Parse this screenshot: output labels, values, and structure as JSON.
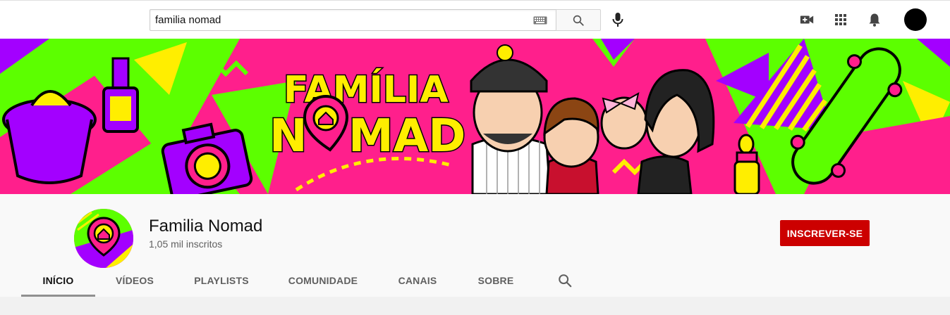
{
  "masthead": {
    "search_value": "familia nomad",
    "icons": [
      "keyboard-icon",
      "search-icon",
      "mic-icon",
      "create-video-icon",
      "apps-grid-icon",
      "bell-icon",
      "avatar"
    ]
  },
  "banner": {
    "title_line1": "FAMÍLIA",
    "title_line2_a": "N",
    "title_line2_b": "MAD",
    "colors": {
      "pink": "#ff1f8c",
      "green": "#5cff00",
      "yellow": "#ffee00",
      "purple": "#a300ff"
    }
  },
  "channel": {
    "name": "Familia Nomad",
    "subscribers": "1,05 mil inscritos",
    "subscribe_label": "INSCREVER-SE",
    "subscribe_color": "#cc0000"
  },
  "tabs": [
    {
      "label": "INÍCIO",
      "active": true
    },
    {
      "label": "VÍDEOS",
      "active": false
    },
    {
      "label": "PLAYLISTS",
      "active": false
    },
    {
      "label": "COMUNIDADE",
      "active": false
    },
    {
      "label": "CANAIS",
      "active": false
    },
    {
      "label": "SOBRE",
      "active": false
    }
  ]
}
